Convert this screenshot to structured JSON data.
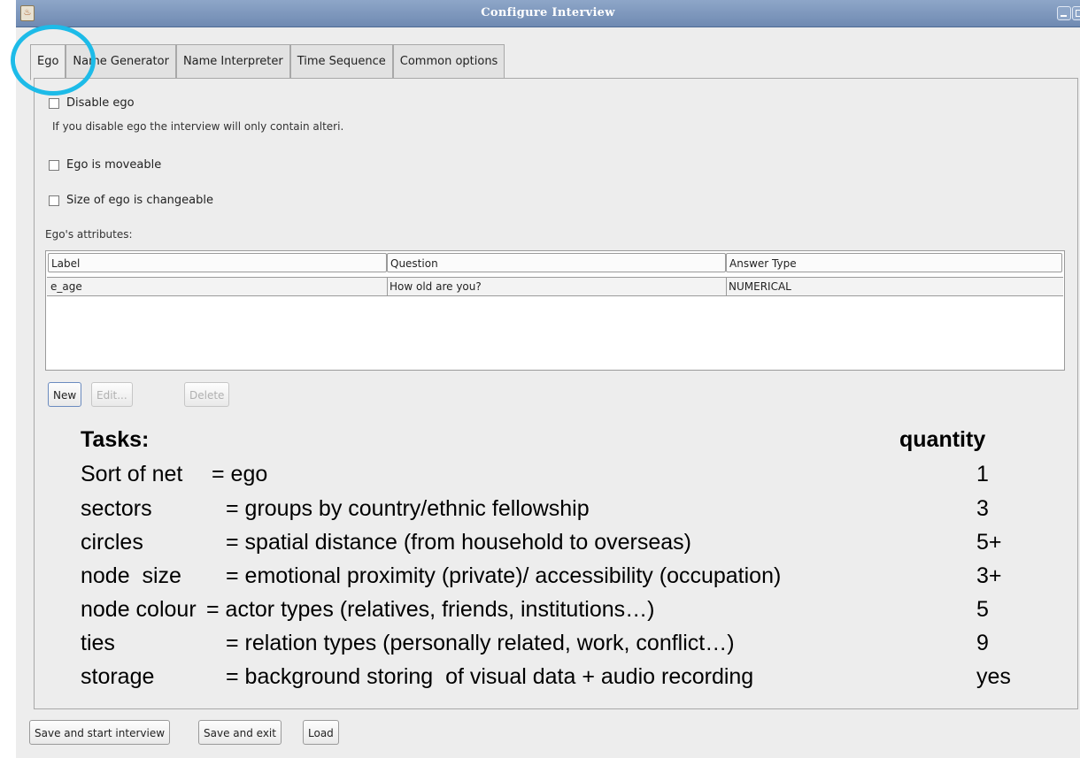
{
  "window": {
    "title": "Configure Interview"
  },
  "tabs": [
    "Ego",
    "Name Generator",
    "Name Interpreter",
    "Time Sequence",
    "Common options"
  ],
  "ego_tab": {
    "disable_ego_label": "Disable ego",
    "disable_ego_hint": "If you disable ego the interview will only contain alteri.",
    "moveable_label": "Ego is moveable",
    "size_changeable_label": "Size of ego is changeable",
    "attributes_label": "Ego's attributes:",
    "table": {
      "headers": [
        "Label",
        "Question",
        "Answer Type"
      ],
      "rows": [
        [
          "e_age",
          "How old are you?",
          "NUMERICAL"
        ]
      ]
    },
    "buttons": {
      "new": "New",
      "edit": "Edit...",
      "delete": "Delete"
    }
  },
  "overlay": {
    "tasks_heading": "Tasks:",
    "quantity_heading": "quantity",
    "rows": [
      {
        "term": "Sort of net",
        "desc": "= ego",
        "qty": "1"
      },
      {
        "term": "sectors",
        "desc": "= groups by country/ethnic fellowship",
        "qty": "3"
      },
      {
        "term": "circles",
        "desc": "= spatial distance (from household to overseas)",
        "qty": "5+"
      },
      {
        "term": "node  size",
        "desc": "= emotional proximity (private)/ accessibility (occupation)",
        "qty": "3+"
      },
      {
        "term": "node colour",
        "desc": "= actor types (relatives, friends, institutions…)",
        "qty": "5"
      },
      {
        "term": "ties",
        "desc": "= relation types (personally related, work, conflict…)",
        "qty": "9"
      },
      {
        "term": "storage",
        "desc": "= background storing  of visual data + audio recording",
        "qty": "yes"
      }
    ]
  },
  "footer": {
    "save_start": "Save and start interview",
    "save_exit": "Save and exit",
    "load": "Load"
  },
  "colors": {
    "highlight_circle": "#1dbbe8",
    "titlebar": "#7f98be"
  }
}
